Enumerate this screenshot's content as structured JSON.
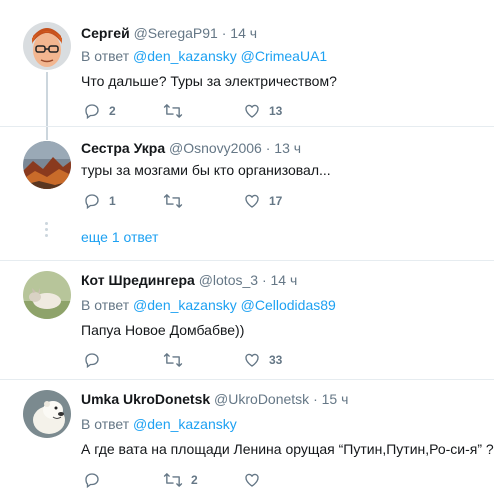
{
  "tweets": [
    {
      "name": "Сергей",
      "handle": "@SeregaP91",
      "time": "14 ч",
      "reply_prefix": "В ответ",
      "reply_to": [
        "@den_kazansky",
        "@CrimeaUA1"
      ],
      "text": "Что дальше? Туры за электричеством?",
      "replies": "2",
      "retweets": "",
      "likes": "13"
    },
    {
      "name": "Сестра Укра",
      "handle": "@Osnovy2006",
      "time": "13 ч",
      "text": "туры за мозгами бы кто организовал...",
      "replies": "1",
      "retweets": "",
      "likes": "17"
    },
    {
      "name": "Кот Шредингера",
      "handle": "@lotos_3",
      "time": "14 ч",
      "reply_prefix": "В ответ",
      "reply_to": [
        "@den_kazansky",
        "@Cellodidas89"
      ],
      "text": "Папуа Новое Домбабве))",
      "replies": "",
      "retweets": "",
      "likes": "33"
    },
    {
      "name": "Umka UkroDonetsk",
      "handle": "@UkroDonetsk",
      "time": "15 ч",
      "reply_prefix": "В ответ",
      "reply_to": [
        "@den_kazansky"
      ],
      "text": "А где вата на площади Ленина орущая “Путин,Путин,Ро-си-я” ?",
      "replies": "",
      "retweets": "2",
      "likes": ""
    }
  ],
  "show_more": "еще 1 ответ",
  "colors": {
    "link": "#1da1f2",
    "muted": "#657786",
    "text": "#14171a",
    "line": "#ccd6dd",
    "divider": "#e6ecf0"
  }
}
